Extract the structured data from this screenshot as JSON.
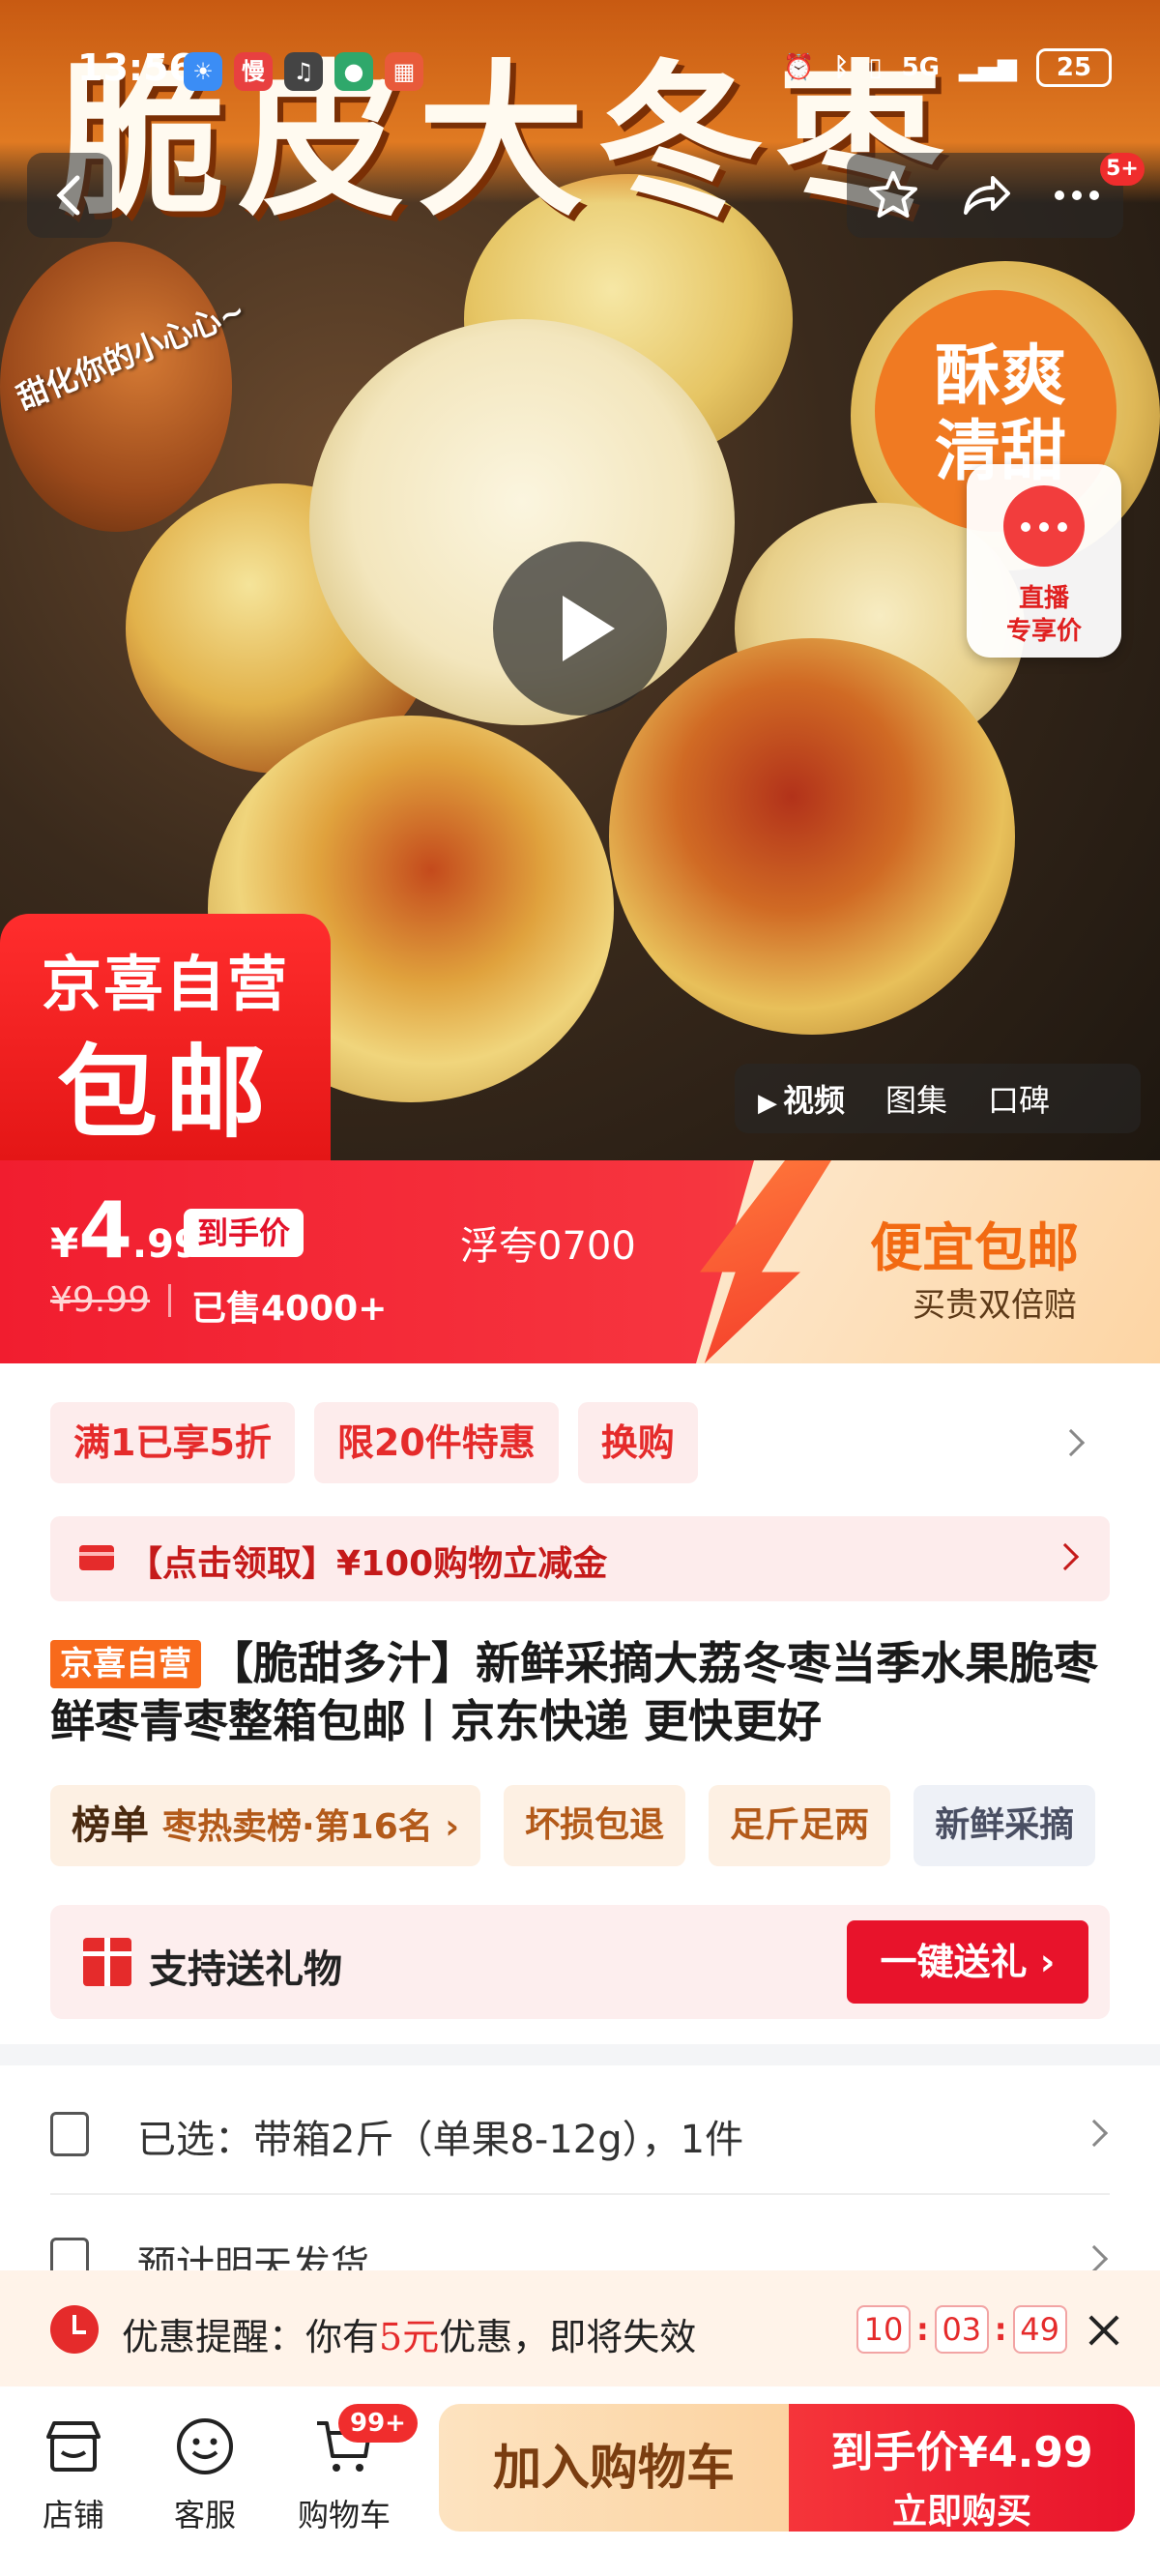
{
  "status_bar": {
    "time": "13:56",
    "battery": "25",
    "network": "5G"
  },
  "hero": {
    "title": "脆皮大冬枣",
    "slogan": "甜化你的小心心~",
    "badge_line1": "酥爽",
    "badge_line2": "清甜",
    "promo_line1": "京喜自营",
    "promo_line2": "包邮",
    "live_line1": "直播",
    "live_line2": "专享价",
    "media_tabs": [
      "视频",
      "图集",
      "口碑"
    ],
    "nav_badge": "5+"
  },
  "price": {
    "currency": "¥",
    "integer": "4",
    "decimal": ".99",
    "tag": "到手价",
    "original": "¥9.99",
    "sold": "已售4000+",
    "code": "浮夸0700",
    "right_title": "便宜包邮",
    "right_sub": "买贵双倍赔"
  },
  "promotions": [
    "满1已享5折",
    "限20件特惠",
    "换购"
  ],
  "coupon": {
    "text": "【点击领取】¥100购物立减金"
  },
  "product": {
    "self_tag": "京喜自营",
    "title": "【脆甜多汁】新鲜采摘大荔冬枣当季水果脆枣鲜枣青枣整箱包邮丨京东快递 更快更好"
  },
  "tags": {
    "rank_label": "榜单",
    "rank_text": "枣热卖榜·第16名 ›",
    "items": [
      "坏损包退",
      "足斤足两",
      "新鲜采摘"
    ]
  },
  "gift": {
    "text": "支持送礼物",
    "button": "一键送礼 ›"
  },
  "selection": {
    "selected": "已选：带箱2斤（单果8-12g），1件",
    "shipping": "预计明天发货"
  },
  "reminder": {
    "prefix": "优惠提醒：你有",
    "amount": "5元",
    "suffix": "优惠，即将失效",
    "timer": [
      "10",
      "03",
      "49"
    ]
  },
  "bottom_bar": {
    "shop": "店铺",
    "service": "客服",
    "cart": "购物车",
    "cart_badge": "99+",
    "add_cart": "加入购物车",
    "buy_line1": "到手价¥4.99",
    "buy_line2": "立即购买"
  },
  "colors": {
    "accent": "#e8132b",
    "orange": "#f86a1b",
    "chip_bg": "#fdecec"
  }
}
